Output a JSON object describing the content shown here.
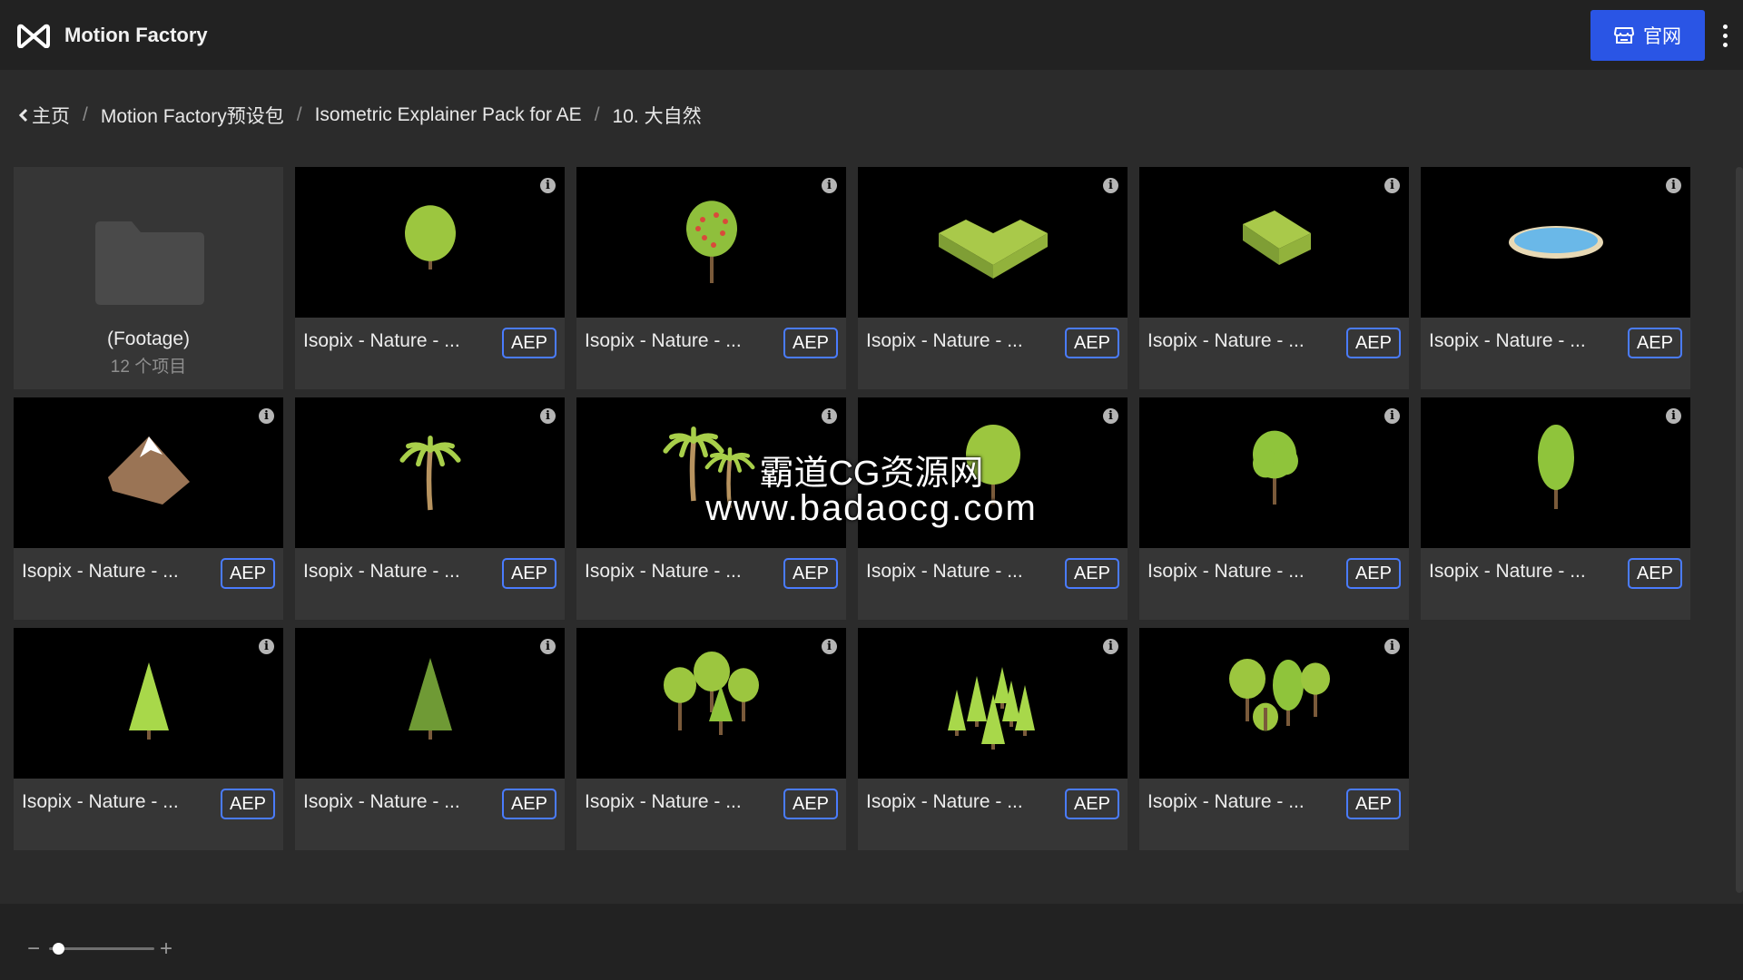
{
  "header": {
    "app_title": "Motion Factory",
    "site_button_label": "官网",
    "accent_color": "#2a55e5"
  },
  "breadcrumb": {
    "items": [
      "主页",
      "Motion Factory预设包",
      "Isometric Explainer Pack for AE",
      "10. 大自然"
    ],
    "separator": "/"
  },
  "folder": {
    "title": "(Footage)",
    "count": "12 个项目"
  },
  "items": [
    {
      "title": "Isopix - Nature - ...",
      "badge": "AEP",
      "thumb": "round-tree-icon"
    },
    {
      "title": "Isopix - Nature - ...",
      "badge": "AEP",
      "thumb": "fruit-tree-icon"
    },
    {
      "title": "Isopix - Nature - ...",
      "badge": "AEP",
      "thumb": "corner-hedge-icon"
    },
    {
      "title": "Isopix - Nature - ...",
      "badge": "AEP",
      "thumb": "hedge-block-icon"
    },
    {
      "title": "Isopix - Nature - ...",
      "badge": "AEP",
      "thumb": "pond-icon"
    },
    {
      "title": "Isopix - Nature - ...",
      "badge": "AEP",
      "thumb": "mountain-icon"
    },
    {
      "title": "Isopix - Nature - ...",
      "badge": "AEP",
      "thumb": "palm-tree-icon"
    },
    {
      "title": "Isopix - Nature - ...",
      "badge": "AEP",
      "thumb": "palm-group-icon"
    },
    {
      "title": "Isopix - Nature - ...",
      "badge": "AEP",
      "thumb": "wide-tree-icon"
    },
    {
      "title": "Isopix - Nature - ...",
      "badge": "AEP",
      "thumb": "bushy-tree-icon"
    },
    {
      "title": "Isopix - Nature - ...",
      "badge": "AEP",
      "thumb": "tall-tree-icon"
    },
    {
      "title": "Isopix - Nature - ...",
      "badge": "AEP",
      "thumb": "cone-tree-icon"
    },
    {
      "title": "Isopix - Nature - ...",
      "badge": "AEP",
      "thumb": "pine-tree-icon"
    },
    {
      "title": "Isopix - Nature - ...",
      "badge": "AEP",
      "thumb": "tree-cluster-icon"
    },
    {
      "title": "Isopix - Nature - ...",
      "badge": "AEP",
      "thumb": "pine-forest-icon"
    },
    {
      "title": "Isopix - Nature - ...",
      "badge": "AEP",
      "thumb": "mixed-trees-icon"
    }
  ],
  "watermark": {
    "line1": "霸道CG资源网",
    "line2": "www.badaocg.com"
  },
  "zoom": {
    "minus": "−",
    "plus": "+",
    "level": 0.05
  }
}
